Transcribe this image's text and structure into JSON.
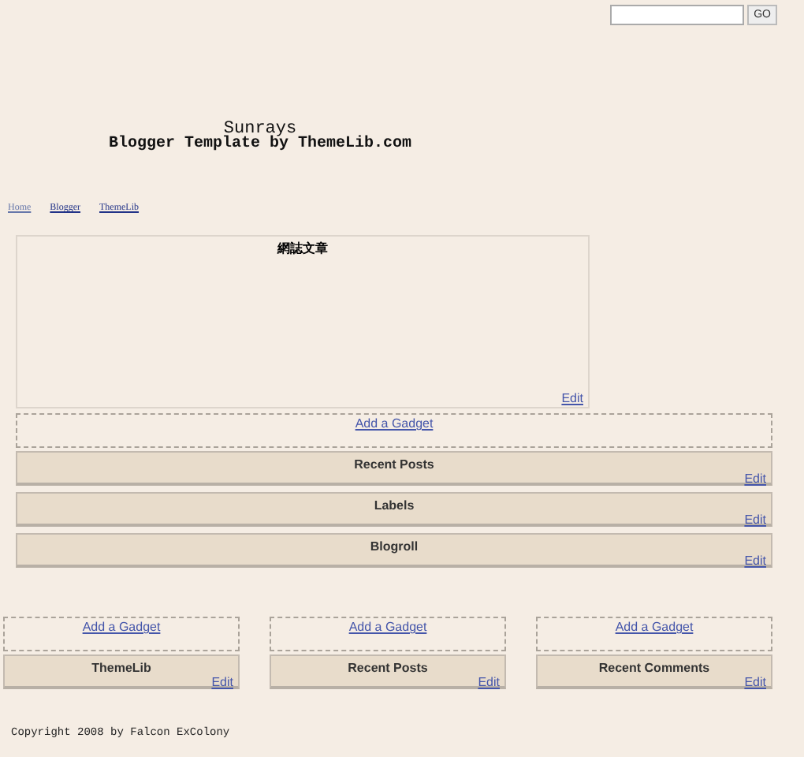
{
  "search": {
    "button": "GO"
  },
  "header": {
    "title": "Sunrays",
    "subtitle": "Blogger Template by ThemeLib.com"
  },
  "nav": [
    "Home",
    "Blogger",
    "ThemeLib"
  ],
  "main": {
    "title": "網誌文章",
    "edit": "Edit"
  },
  "sidebar": {
    "add_gadget": "Add a Gadget",
    "widgets": [
      {
        "title": "Recent Posts",
        "edit": "Edit"
      },
      {
        "title": "Labels",
        "edit": "Edit"
      },
      {
        "title": "Blogroll",
        "edit": "Edit"
      }
    ]
  },
  "footer_columns": [
    {
      "add_gadget": "Add a Gadget",
      "widget": {
        "title": "ThemeLib",
        "edit": "Edit"
      }
    },
    {
      "add_gadget": "Add a Gadget",
      "widget": {
        "title": "Recent Posts",
        "edit": "Edit"
      }
    },
    {
      "add_gadget": "Add a Gadget",
      "widget": {
        "title": "Recent Comments",
        "edit": "Edit"
      }
    }
  ],
  "copyright": "Copyright 2008 by Falcon ExColony"
}
